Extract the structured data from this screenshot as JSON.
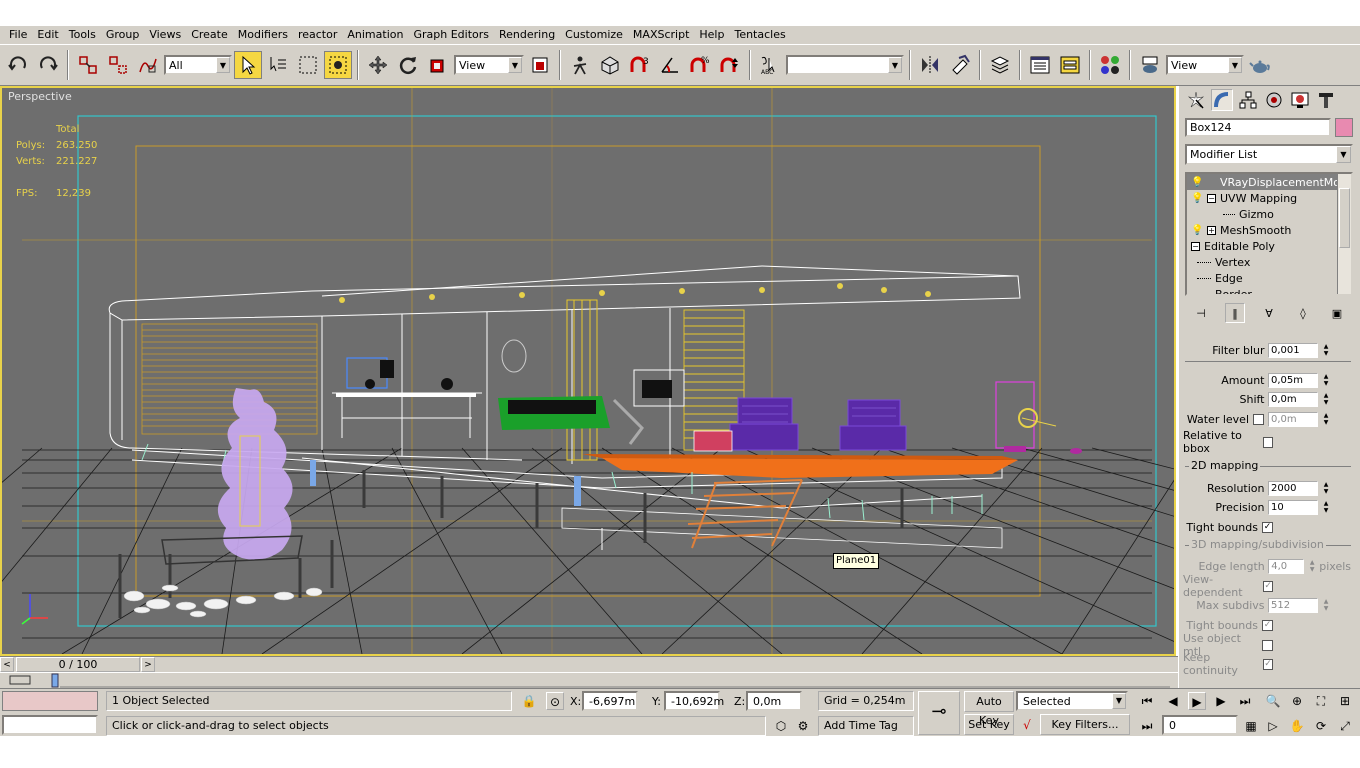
{
  "menu": [
    "File",
    "Edit",
    "Tools",
    "Group",
    "Views",
    "Create",
    "Modifiers",
    "reactor",
    "Animation",
    "Graph Editors",
    "Rendering",
    "Customize",
    "MAXScript",
    "Help",
    "Tentacles"
  ],
  "toolbar": {
    "selection_filter": "All",
    "ref_coord_1": "View",
    "ref_coord_2": "View",
    "named_selection": ""
  },
  "viewport": {
    "label": "Perspective",
    "stats": {
      "header": "Total",
      "polys_label": "Polys:",
      "polys": "263.250",
      "verts_label": "Verts:",
      "verts": "221.227",
      "fps_label": "FPS:",
      "fps": "12,239"
    },
    "tooltip": "Plane01"
  },
  "command_panel": {
    "object_name": "Box124",
    "object_color": "#e88ab0",
    "modifier_list_label": "Modifier List",
    "stack": [
      {
        "label": "VRayDisplacementMod",
        "selected": true,
        "bulb": true,
        "box": ""
      },
      {
        "label": "UVW Mapping",
        "selected": false,
        "bulb": true,
        "box": "−"
      },
      {
        "label": "Gizmo",
        "selected": false,
        "bulb": false,
        "box": ""
      },
      {
        "label": "MeshSmooth",
        "selected": false,
        "bulb": true,
        "box": "+"
      },
      {
        "label": "Editable Poly",
        "selected": false,
        "bulb": false,
        "box": "−"
      },
      {
        "label": "Vertex",
        "selected": false,
        "bulb": false,
        "box": ""
      },
      {
        "label": "Edge",
        "selected": false,
        "bulb": false,
        "box": ""
      },
      {
        "label": "Border",
        "selected": false,
        "bulb": false,
        "box": ""
      }
    ],
    "params": {
      "filter_blur_label": "Filter blur",
      "filter_blur": "0,001",
      "amount_label": "Amount",
      "amount": "0,05m",
      "shift_label": "Shift",
      "shift": "0,0m",
      "water_level_label": "Water level",
      "water_level": "0,0m",
      "relative_to_bbox_label": "Relative to bbox",
      "group_2d": "2D mapping",
      "resolution_label": "Resolution",
      "resolution": "2000",
      "precision_label": "Precision",
      "precision": "10",
      "tight_bounds_label": "Tight bounds",
      "group_3d": "3D mapping/subdivision",
      "edge_length_label": "Edge length",
      "edge_length": "4,0",
      "pixels_label": "pixels",
      "view_dependent_label": "View-dependent",
      "max_subdivs_label": "Max subdivs",
      "max_subdivs": "512",
      "tight_bounds_3d_label": "Tight bounds",
      "use_object_mtl_label": "Use object mtl",
      "keep_continuity_label": "Keep continuity"
    }
  },
  "timeslider": {
    "position": "0 / 100"
  },
  "statusbar": {
    "selection_status": "1 Object Selected",
    "prompt": "Click or click-and-drag to select objects",
    "x_label": "X:",
    "x": "-6,697m",
    "y_label": "Y:",
    "y": "-10,692m",
    "z_label": "Z:",
    "z": "0,0m",
    "grid": "Grid = 0,254m",
    "add_time_tag": "Add Time Tag",
    "auto_key": "Auto Key",
    "set_key": "Set Key",
    "key_mode": "Selected",
    "key_filters": "Key Filters...",
    "current_frame": "0"
  }
}
